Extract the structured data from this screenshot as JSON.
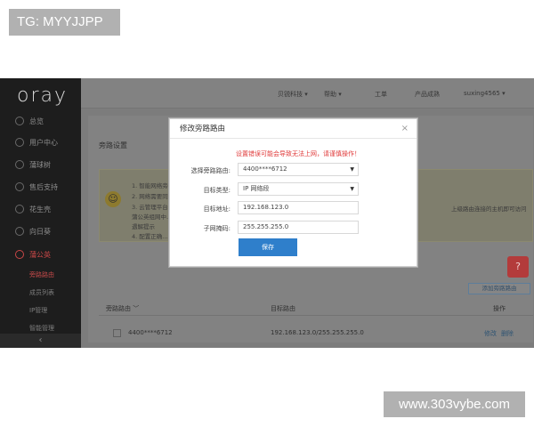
{
  "watermarks": {
    "top_left": "TG: MYYJJPP",
    "bottom_right": "www.303vybe.com"
  },
  "sidebar": {
    "logo": "oray",
    "items": [
      {
        "label": "总览",
        "icon": "grid-icon"
      },
      {
        "label": "用户中心",
        "icon": "user-icon"
      },
      {
        "label": "蒲球树",
        "icon": "globe-icon"
      },
      {
        "label": "售后支持",
        "icon": "support-icon"
      },
      {
        "label": "花生壳",
        "icon": "peanut-icon"
      },
      {
        "label": "向日葵",
        "icon": "sunflower-icon"
      },
      {
        "label": "蒲公英",
        "icon": "dandelion-icon"
      }
    ],
    "sub_items": [
      "旁路路由",
      "成员列表",
      "IP管理",
      "智能管理"
    ],
    "collapse_glyph": "‹"
  },
  "topnav": {
    "items": [
      "贝锐科技 ▾",
      "帮助 ▾",
      "工单",
      "产品成熟",
      "suxing4565 ▾"
    ]
  },
  "main": {
    "breadcrumb": "旁路设置",
    "notice_lines": [
      "1. 智能网络旁路路由...",
      "2. 网络需要同步...",
      "3. 云管理平台...",
      "蒲公英组网中...",
      "遇解提示",
      "4. 配置正确..."
    ],
    "notice_right": "上级路由连接的主机即可访问",
    "add_button": "添加旁路路由",
    "table_headers": [
      "旁路路由 ﹀",
      "目标路由",
      "操作"
    ],
    "row": {
      "router": "4400****6712",
      "target": "192.168.123.0/255.255.255.0",
      "actions": [
        "修改",
        "删除"
      ]
    }
  },
  "modal": {
    "title": "修改旁路路由",
    "close": "×",
    "warning": "设置错误可能会导致无法上网，请谨慎操作！",
    "fields": [
      {
        "label": "选择旁路路由:",
        "value": "4400****6712",
        "dropdown": true
      },
      {
        "label": "目标类型:",
        "value": "IP 网络段",
        "dropdown": true
      },
      {
        "label": "目标地址:",
        "value": "192.168.123.0",
        "dropdown": false
      },
      {
        "label": "子网掩码:",
        "value": "255.255.255.0",
        "dropdown": false
      }
    ],
    "save_label": "保存"
  },
  "help_badge": "?",
  "colors": {
    "primary": "#2f7fcb",
    "warning": "#e03a3a",
    "active_red": "#c94747"
  }
}
